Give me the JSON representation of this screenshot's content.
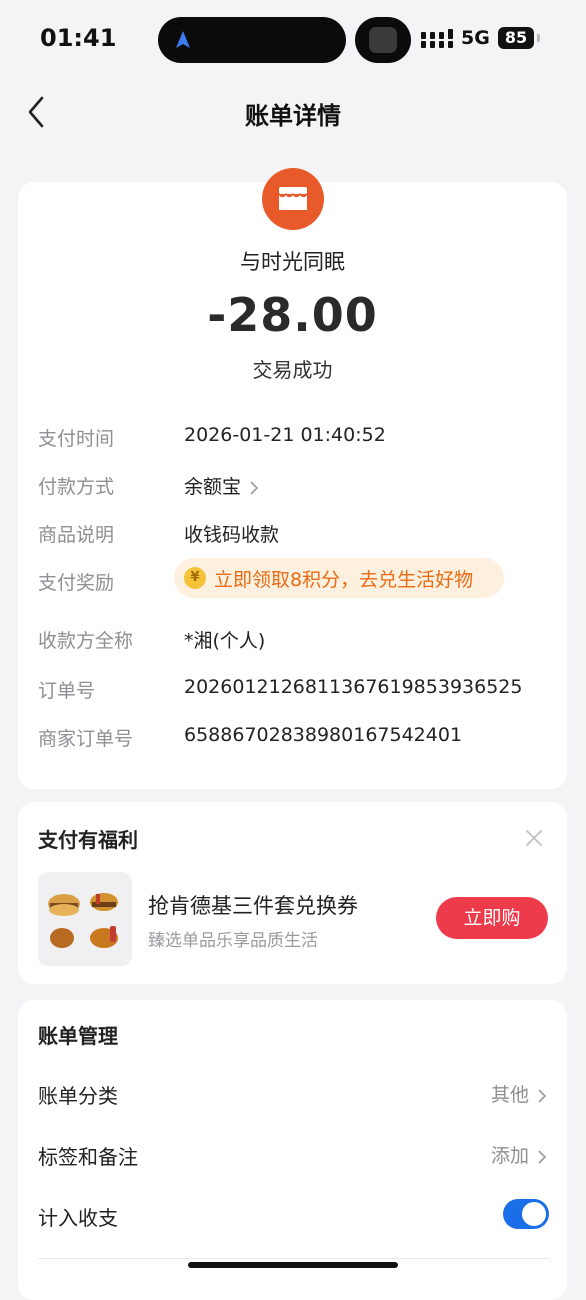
{
  "status_bar": {
    "time": "01:41",
    "network": "5G",
    "battery": "85"
  },
  "nav": {
    "title": "账单详情"
  },
  "transaction": {
    "merchant": "与时光同眠",
    "amount": "-28.00",
    "status": "交易成功"
  },
  "details": {
    "pay_time_label": "支付时间",
    "pay_time": "2026-01-21 01:40:52",
    "method_label": "付款方式",
    "method": "余额宝",
    "desc_label": "商品说明",
    "desc": "收钱码收款",
    "reward_label": "支付奖励",
    "reward": "立即领取8积分，去兑生活好物",
    "reward_coin": "¥",
    "payee_label": "收款方全称",
    "payee": "*湘(个人)",
    "order_label": "订单号",
    "order_no": "2026012126811367619853936525",
    "merchant_order_label": "商家订单号",
    "merchant_order_no": "6588670283898016754240​1"
  },
  "benefits": {
    "title": "支付有福利",
    "promo_title": "抢肯德基三件套兑换券",
    "promo_subtitle": "臻选单品乐享品质生活",
    "buy_label": "立即购"
  },
  "management": {
    "title": "账单管理",
    "category_label": "账单分类",
    "category_value": "其他",
    "tags_label": "标签和备注",
    "tags_value": "添加",
    "include_label": "计入收支",
    "include_on": true
  },
  "colors": {
    "accent": "#1a6fe8",
    "buy": "#ee3b4c",
    "merchant_icon": "#e85a2a",
    "reward_text": "#e86b15"
  }
}
